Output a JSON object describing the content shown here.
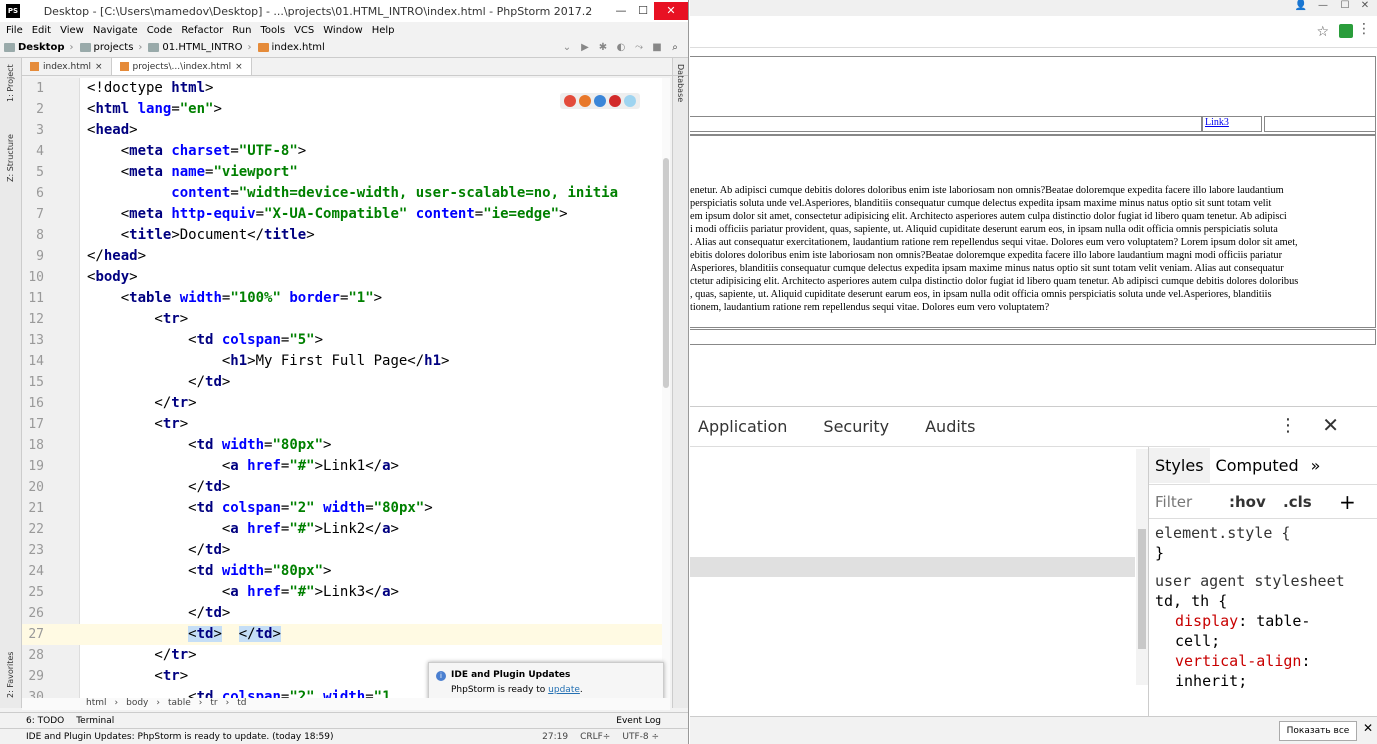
{
  "ide": {
    "title": "Desktop - [C:\\Users\\mamedov\\Desktop] - ...\\projects\\01.HTML_INTRO\\index.html - PhpStorm 2017.2",
    "menu": [
      "File",
      "Edit",
      "View",
      "Navigate",
      "Code",
      "Refactor",
      "Run",
      "Tools",
      "VCS",
      "Window",
      "Help"
    ],
    "breadcrumbs": [
      "Desktop",
      "projects",
      "01.HTML_INTRO",
      "index.html"
    ],
    "tabs": [
      "index.html",
      "projects\\...\\index.html"
    ],
    "side_labels": {
      "project": "1: Project",
      "structure": "Z: Structure",
      "favorites": "2: Favorites",
      "database": "Database"
    },
    "code_lines": [
      {
        "n": "1",
        "html": "&lt;!doctype <b>html</b>&gt;"
      },
      {
        "n": "2",
        "html": "&lt;<b>html</b> <u>lang</u>=<i>\"en\"</i>&gt;"
      },
      {
        "n": "3",
        "html": "&lt;<b>head</b>&gt;"
      },
      {
        "n": "4",
        "html": "    &lt;<b>meta</b> <u>charset</u>=<i>\"UTF-8\"</i>&gt;"
      },
      {
        "n": "5",
        "html": "    &lt;<b>meta</b> <u>name</u>=<i>\"viewport\"</i>"
      },
      {
        "n": "6",
        "html": "          <u>content</u>=<i>\"width=device-width, user-scalable=no, initia</i>"
      },
      {
        "n": "7",
        "html": "    &lt;<b>meta</b> <u>http-equiv</u>=<i>\"X-UA-Compatible\"</i> <u>content</u>=<i>\"ie=edge\"</i>&gt;"
      },
      {
        "n": "8",
        "html": "    &lt;<b>title</b>&gt;Document&lt;/<b>title</b>&gt;"
      },
      {
        "n": "9",
        "html": "&lt;/<b>head</b>&gt;"
      },
      {
        "n": "10",
        "html": "&lt;<b>body</b>&gt;"
      },
      {
        "n": "11",
        "html": "    &lt;<b>table</b> <u>width</u>=<i>\"100%\"</i> <u>border</u>=<i>\"1\"</i>&gt;"
      },
      {
        "n": "12",
        "html": "        &lt;<b>tr</b>&gt;"
      },
      {
        "n": "13",
        "html": "            &lt;<b>td</b> <u>colspan</u>=<i>\"5\"</i>&gt;"
      },
      {
        "n": "14",
        "html": "                &lt;<b>h1</b>&gt;My First Full Page&lt;/<b>h1</b>&gt;"
      },
      {
        "n": "15",
        "html": "            &lt;/<b>td</b>&gt;"
      },
      {
        "n": "16",
        "html": "        &lt;/<b>tr</b>&gt;"
      },
      {
        "n": "17",
        "html": "        &lt;<b>tr</b>&gt;"
      },
      {
        "n": "18",
        "html": "            &lt;<b>td</b> <u>width</u>=<i>\"80px\"</i>&gt;"
      },
      {
        "n": "19",
        "html": "                &lt;<b>a</b> <u>href</u>=<i>\"#\"</i>&gt;Link1&lt;/<b>a</b>&gt;"
      },
      {
        "n": "20",
        "html": "            &lt;/<b>td</b>&gt;"
      },
      {
        "n": "21",
        "html": "            &lt;<b>td</b> <u>colspan</u>=<i>\"2\"</i> <u>width</u>=<i>\"80px\"</i>&gt;"
      },
      {
        "n": "22",
        "html": "                &lt;<b>a</b> <u>href</u>=<i>\"#\"</i>&gt;Link2&lt;/<b>a</b>&gt;"
      },
      {
        "n": "23",
        "html": "            &lt;/<b>td</b>&gt;"
      },
      {
        "n": "24",
        "html": "            &lt;<b>td</b> <u>width</u>=<i>\"80px\"</i>&gt;"
      },
      {
        "n": "25",
        "html": "                &lt;<b>a</b> <u>href</u>=<i>\"#\"</i>&gt;Link3&lt;/<b>a</b>&gt;"
      },
      {
        "n": "26",
        "html": "            &lt;/<b>td</b>&gt;"
      },
      {
        "n": "27",
        "html": "            <em>&lt;<b>td</b>&gt;</em>  <em>&lt;/<b>td</b>&gt;</em>"
      },
      {
        "n": "28",
        "html": "        &lt;/<b>tr</b>&gt;"
      },
      {
        "n": "29",
        "html": "        &lt;<b>tr</b>&gt;"
      },
      {
        "n": "30",
        "html": "            &lt;<b>td</b> <u>colspan</u>=<i>\"2\"</i> <u>width</u>=<i>\"1</i>"
      }
    ],
    "popup": {
      "title": "IDE and Plugin Updates",
      "text": "PhpStorm is ready to ",
      "link": "update",
      "dot": "."
    },
    "code_breadcrumb": [
      "html",
      "body",
      "table",
      "tr",
      "td"
    ],
    "toolwindows": {
      "todo": "6: TODO",
      "terminal": "Terminal",
      "eventlog": "Event Log"
    },
    "status": {
      "message": "IDE and Plugin Updates: PhpStorm is ready to update. (today 18:59)",
      "position": "27:19",
      "line_sep": "CRLF÷",
      "encoding": "UTF-8 ÷"
    }
  },
  "browser": {
    "link3": "Link3",
    "lorem_lines": [
      "enetur. Ab adipisci cumque debitis dolores doloribus enim iste laboriosam non omnis?Beatae doloremque expedita facere illo labore laudantium",
      "perspiciatis soluta unde vel.Asperiores, blanditiis consequatur cumque delectus expedita ipsam maxime minus natus optio sit sunt totam velit",
      "em ipsum dolor sit amet, consectetur adipisicing elit. Architecto asperiores autem culpa distinctio dolor fugiat id libero quam tenetur. Ab adipisci",
      "i modi officiis pariatur provident, quas, sapiente, ut. Aliquid cupiditate deserunt earum eos, in ipsam nulla odit officia omnis perspiciatis soluta",
      ". Alias aut consequatur exercitationem, laudantium ratione rem repellendus sequi vitae. Dolores eum vero voluptatem? Lorem ipsum dolor sit amet,",
      "ebitis dolores doloribus enim iste laboriosam non omnis?Beatae doloremque expedita facere illo labore laudantium magni modi officiis pariatur",
      "Asperiores, blanditiis consequatur cumque delectus expedita ipsam maxime minus natus optio sit sunt totam velit veniam. Alias aut consequatur",
      "ctetur adipisicing elit. Architecto asperiores autem culpa distinctio dolor fugiat id libero quam tenetur. Ab adipisci cumque debitis dolores doloribus",
      ", quas, sapiente, ut. Aliquid cupiditate deserunt earum eos, in ipsam nulla odit officia omnis perspiciatis soluta unde vel.Asperiores, blanditiis",
      "tionem, laudantium ratione rem repellendus sequi vitae. Dolores eum vero voluptatem?"
    ],
    "devtools": {
      "tabs": [
        "Application",
        "Security",
        "Audits"
      ],
      "styles_tabs": [
        "Styles",
        "Computed"
      ],
      "filter": "Filter",
      "hov": ":hov",
      "cls": ".cls",
      "lines": [
        {
          "t": "element.style {",
          "c": ""
        },
        {
          "t": "}",
          "c": ""
        },
        {
          "t": " user agent stylesheet",
          "c": "#333"
        },
        {
          "t": "td, th {",
          "c": ""
        }
      ],
      "props": [
        {
          "p": "display",
          "v": " table-"
        },
        {
          "p": "",
          "v": "    cell;"
        },
        {
          "p": "vertical-align",
          "v": ""
        },
        {
          "p": "",
          "v": "    inherit;"
        }
      ]
    },
    "show_all": "Показать все"
  }
}
